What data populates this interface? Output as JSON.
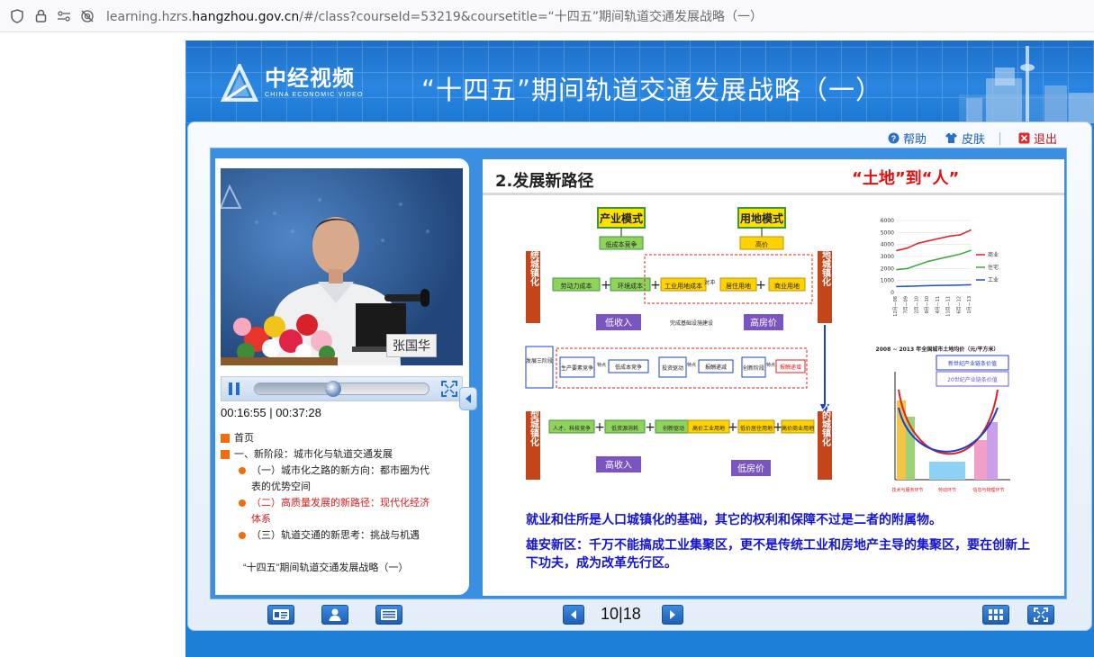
{
  "browser": {
    "url_prefix": "learning.hzrs.",
    "url_host": "hangzhou.gov.cn",
    "url_rest": "/#/class?courseId=53219&coursetitle=“十四五”期间轨道交通发展战略（一）"
  },
  "header": {
    "logo_cn": "中经视频",
    "logo_en": "CHINA ECONOMIC VIDEO",
    "course_title": "“十四五”期间轨道交通发展战略（一）"
  },
  "top_links": {
    "help": "帮助",
    "skin": "皮肤",
    "exit": "退出"
  },
  "video": {
    "speaker_name": "张国华",
    "current_time": "00:16:55",
    "separator": "|",
    "total_time": "00:37:28",
    "progress": 0.45
  },
  "toc": {
    "items": [
      {
        "label": "首页",
        "level": 1
      },
      {
        "label": "一、新阶段：城市化与轨道交通发展",
        "level": 1
      },
      {
        "label": "（一）城市化之路的新方向：都市圈为代表的优势空间",
        "level": 2
      },
      {
        "label": "（二）高质量发展的新路径：现代化经济体系",
        "level": 2,
        "active": true
      },
      {
        "label": "（三）轨道交通的新思考：挑战与机遇",
        "level": 2
      },
      {
        "label": "“十四五”期间轨道交通发展战略（一）",
        "level": 1,
        "partial": true
      }
    ]
  },
  "slide": {
    "heading": "2.发展新路径",
    "tag": "“土地”到“人”",
    "line1": "就业和住所是人口城镇化的基础，其它的权利和保障不过是二者的附属物。",
    "line2a": "雄安新区：千万不能搞成工业集聚区，更不是传统工业和房地产主导的集聚区，要在创新上",
    "line2b": "下功夫，成为改革先行区。",
    "diagram": {
      "box_industry_mode": "产业模式",
      "box_land_mode": "用地模式",
      "low_cost_comp": "低成本竞争",
      "high_price": "高价",
      "labor_cost": "劳动力成本",
      "env_cost": "环境成本",
      "ind_land_cost": "工业用地成本",
      "oppose": "对冲",
      "res_land": "居住用地",
      "com_land": "商业用地",
      "low_income": "低收入",
      "infra": "完成基础设施建设",
      "high_house": "高房价",
      "traditional": "传统城镇化",
      "land_side": "土地城镇化",
      "three_stage": "发展三阶段",
      "factor_comp": "生产要素竞争",
      "features": "特点",
      "low_cost_comp2": "低成本竞争",
      "invest_driven": "投资驱动",
      "features2": "特点",
      "rising_costs": "报酬递减",
      "innovation": "创新阶段",
      "features3": "特点",
      "increasing": "报酬递增",
      "new_type": "新型城镇化",
      "human_side": "人的城镇化",
      "talent_tech": "人才、科技竞争",
      "low_resource": "低资源消耗",
      "innovation_driven": "创新驱动",
      "high_price_ind": "高价工业用地",
      "low_price_res": "低价居住用地",
      "high_price_com": "高价商业用地",
      "high_income": "高收入",
      "low_house": "低房价"
    }
  },
  "chart_data": {
    "type": "line",
    "title": "2008 ~ 2013 年全国城市土地均价（元/平方米）",
    "x": [
      "12月—08",
      "7月—09",
      "2月—10",
      "9月—10",
      "4月—11",
      "11月—11",
      "6月—12",
      "1月—13"
    ],
    "ylim": [
      0,
      6000
    ],
    "yticks": [
      "6000",
      "5000",
      "4000",
      "3000",
      "2000",
      "1000",
      "0"
    ],
    "series": [
      {
        "name": "商业",
        "color": "#e02020",
        "values": [
          3500,
          3700,
          4100,
          4300,
          4500,
          4700,
          4800,
          5200
        ]
      },
      {
        "name": "住宅",
        "color": "#3aa835",
        "values": [
          1900,
          2000,
          2300,
          2600,
          2800,
          3000,
          3200,
          3500
        ]
      },
      {
        "name": "工业",
        "color": "#1f4fc8",
        "values": [
          500,
          520,
          540,
          570,
          590,
          600,
          620,
          650
        ]
      }
    ]
  },
  "smile_curve": {
    "label_top1": "新世纪产业链条价值",
    "label_top2": "20世纪产业链条价值",
    "axis_labels": [
      "技术与服务环节",
      "劳动环节",
      "信息与物理环节"
    ]
  },
  "bottom_bar": {
    "page_current": "10",
    "page_sep": "|",
    "page_total": "18"
  },
  "colors": {
    "accent": "#1e7fd8",
    "toc_bullet": "#f36c0a",
    "toc_active": "#e01b1b",
    "slide_blue_text": "#1414d6",
    "slide_red_text": "#e30e0e"
  },
  "icons": {
    "shield": "shield-icon",
    "lock": "lock-icon",
    "permissions": "permissions-icon",
    "camera_off": "camera-off-icon",
    "help": "help-icon",
    "skin": "shirt-icon",
    "exit": "close-icon",
    "pause": "pause-icon",
    "fullscreen": "fullscreen-icon",
    "collapse": "chevron-left-icon",
    "prev": "prev-icon",
    "next": "next-icon",
    "grid": "grid-icon",
    "expand": "expand-icon",
    "card": "id-card-icon",
    "person": "person-icon",
    "list": "list-icon"
  }
}
